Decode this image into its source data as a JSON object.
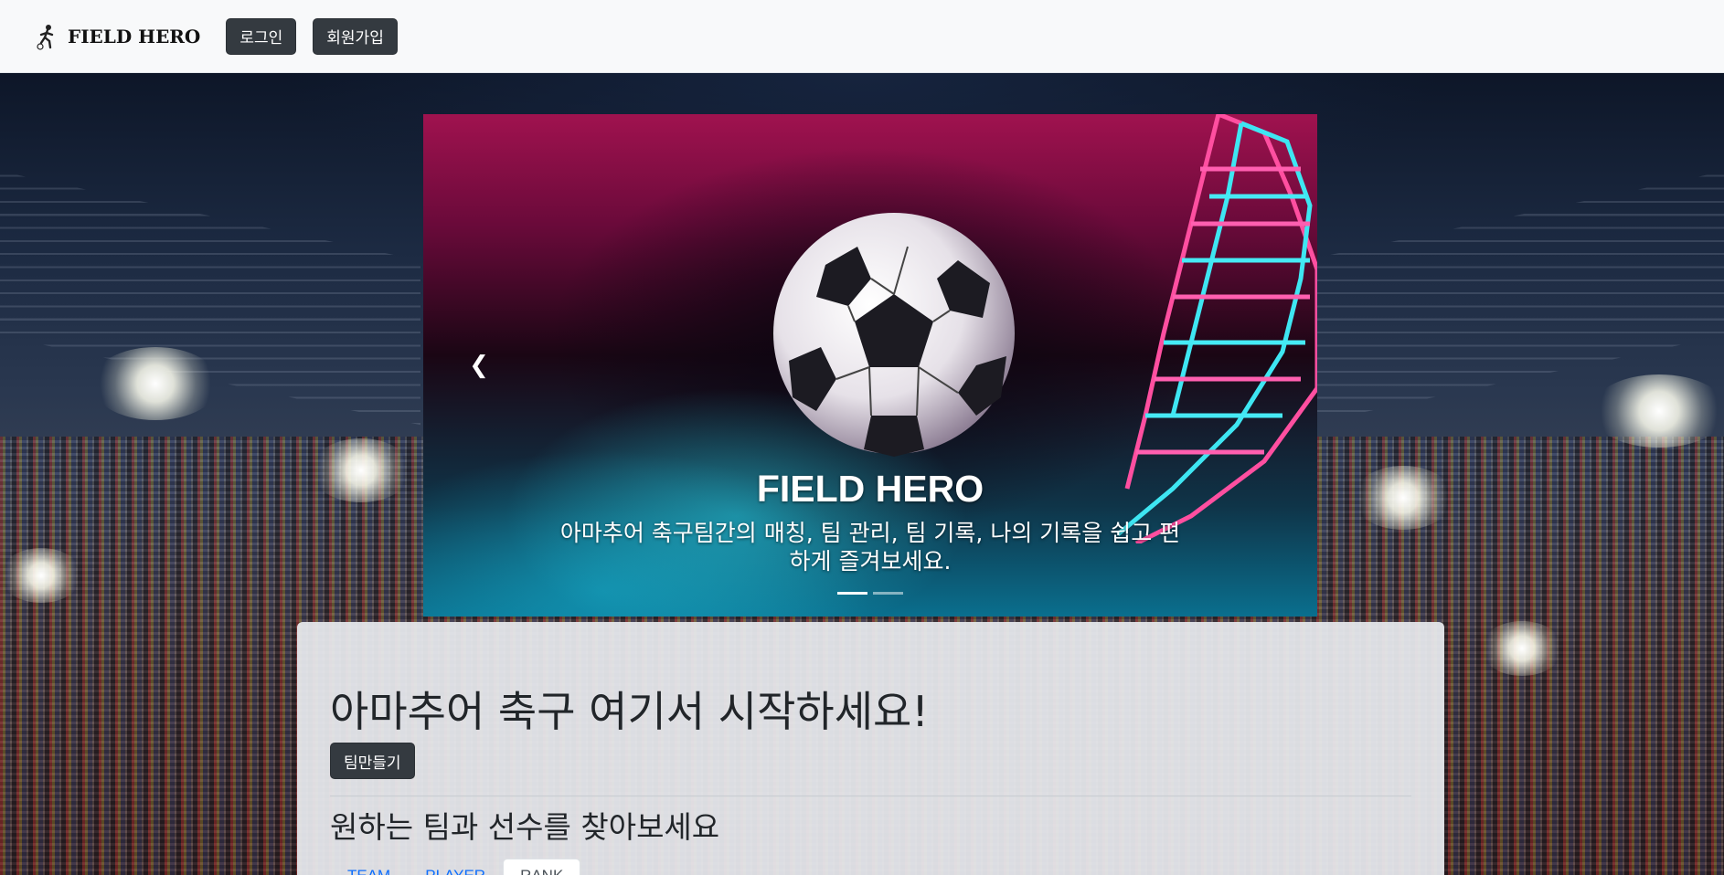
{
  "navbar": {
    "brand_name": "FIELD HERO",
    "brand_icon": "soccer-player-icon",
    "login_label": "로그인",
    "signup_label": "회원가입"
  },
  "carousel": {
    "prev_icon": "chevron-left-icon",
    "title": "FIELD HERO",
    "text": "아마추어 축구팀간의 매칭, 팀 관리, 팀 기록, 나의 기록을 쉽고 편하게 즐겨보세요.",
    "slide_count": 2,
    "active_slide": 1
  },
  "main": {
    "title": "아마추어 축구 여기서 시작하세요!",
    "create_team_label": "팀만들기",
    "subtitle": "원하는 팀과 선수를 찾아보세요",
    "tabs": [
      {
        "label": "TEAM"
      },
      {
        "label": "PLAYER"
      },
      {
        "label": "RANK"
      }
    ],
    "active_tab": 2
  },
  "colors": {
    "dark_button": "#343a40",
    "link": "#0d6efd",
    "navbar_bg": "#f8f9fa"
  }
}
